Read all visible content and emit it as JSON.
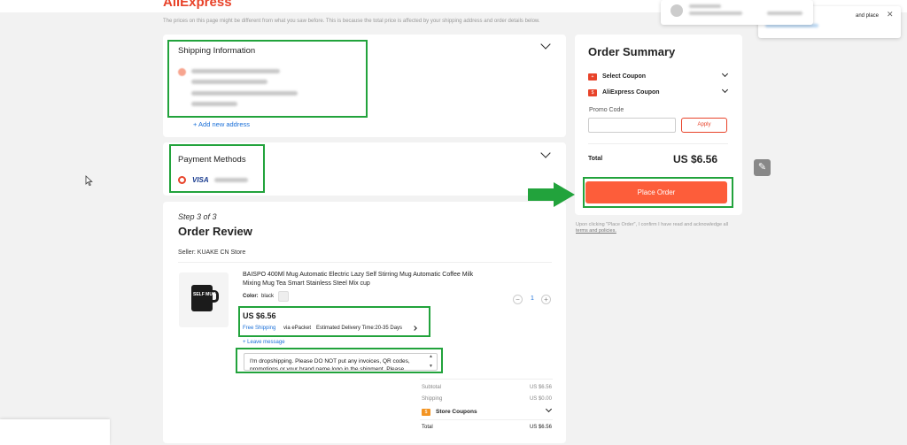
{
  "header": {
    "logo": "AliExpress",
    "notice": "The prices on this page might be different from what you saw before. This is because the total price is affected by your shipping address and order details below."
  },
  "shipping": {
    "title": "Shipping Information",
    "add_address": "+ Add new address"
  },
  "payment": {
    "title": "Payment Methods",
    "card_brand": "VISA"
  },
  "review": {
    "step": "Step 3 of 3",
    "title": "Order Review",
    "seller": "Seller: KUAKE CN Store",
    "product": {
      "title": "BAISPO 400Ml Mug Automatic Electric Lazy Self Stirring Mug Automatic Coffee Milk Mixing Mug Tea Smart Stainless Steel Mix cup",
      "color_label": "Color:",
      "color_value": "black",
      "price": "US $6.56",
      "free_shipping": "Free Shipping",
      "shipping_method": "via ePacket",
      "delivery": "Estimated Delivery Time:20-35 Days",
      "quantity": "1",
      "thumb_label": "SELF MUG"
    },
    "leave_message": "+ Leave message",
    "message_text": "I'm dropshipping. Please DO NOT put any invoices, QR codes, promotions or your brand name logo in the shipment. Please",
    "subtotal_label": "Subtotal",
    "subtotal_value": "US $6.56",
    "shipping_label": "Shipping",
    "shipping_value": "US $0.00",
    "store_coupons": "Store Coupons",
    "total_label": "Total",
    "total_value": "US $6.56"
  },
  "summary": {
    "title": "Order Summary",
    "select_coupon": "Select Coupon",
    "aliexpress_coupon": "AliExpress Coupon",
    "promo_label": "Promo Code",
    "apply": "Apply",
    "total_label": "Total",
    "total_value": "US $6.56",
    "place_order": "Place Order",
    "disclaimer": "Upon clicking \"Place Order\", I confirm I have read and acknowledge all",
    "terms": "terms and policies."
  },
  "popup": {
    "place_text": "and place"
  },
  "colors": {
    "accent": "#fd5d3a",
    "brand": "#e8432a",
    "annotation_green": "#22a33c"
  }
}
